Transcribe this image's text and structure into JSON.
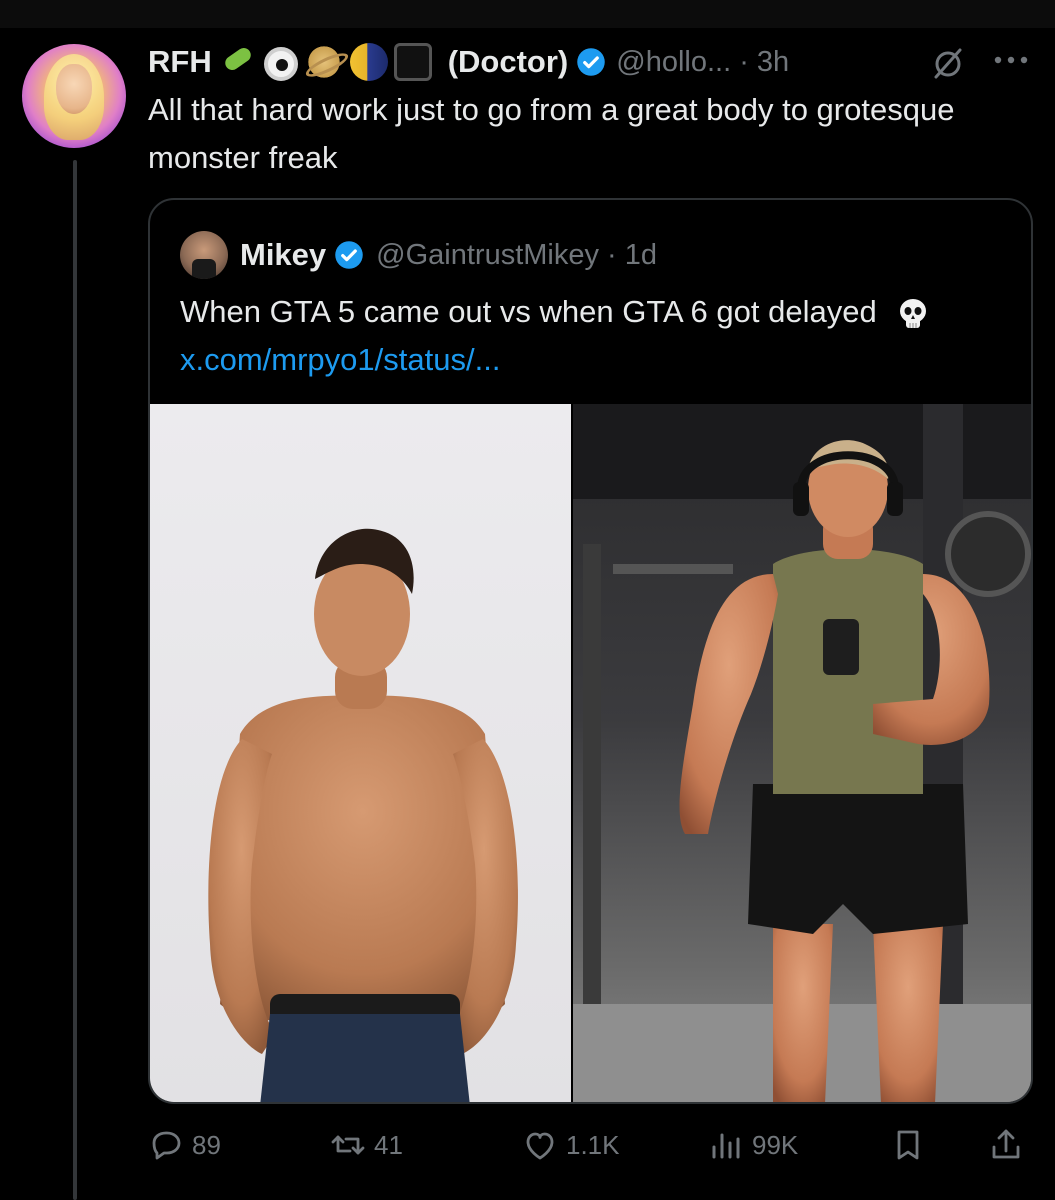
{
  "tweet": {
    "author_name": "RFH",
    "author_emojis": [
      "lizard",
      "eye",
      "saturn",
      "moon",
      "black-square"
    ],
    "author_suffix": "(Doctor)",
    "handle": "@hollo... · 3h",
    "text": "All that hard work just to go from a great body to grotesque monster freak"
  },
  "quote": {
    "author_name": "Mikey",
    "handle": "@GaintrustMikey · 1d",
    "text_before": "When GTA 5 came out vs when GTA 6 got delayed",
    "emoji": "skull",
    "link": "x.com/mrpyo1/status/...",
    "media": [
      {
        "description_icon": "photo-left"
      },
      {
        "description_icon": "photo-right"
      }
    ]
  },
  "actions": {
    "replies": "89",
    "reposts": "41",
    "likes": "1.1K",
    "views": "99K"
  },
  "colors": {
    "background": "#000000",
    "text": "#e7e9ea",
    "muted": "#71767b",
    "accent": "#1d9bf0",
    "border": "#2f3336"
  }
}
